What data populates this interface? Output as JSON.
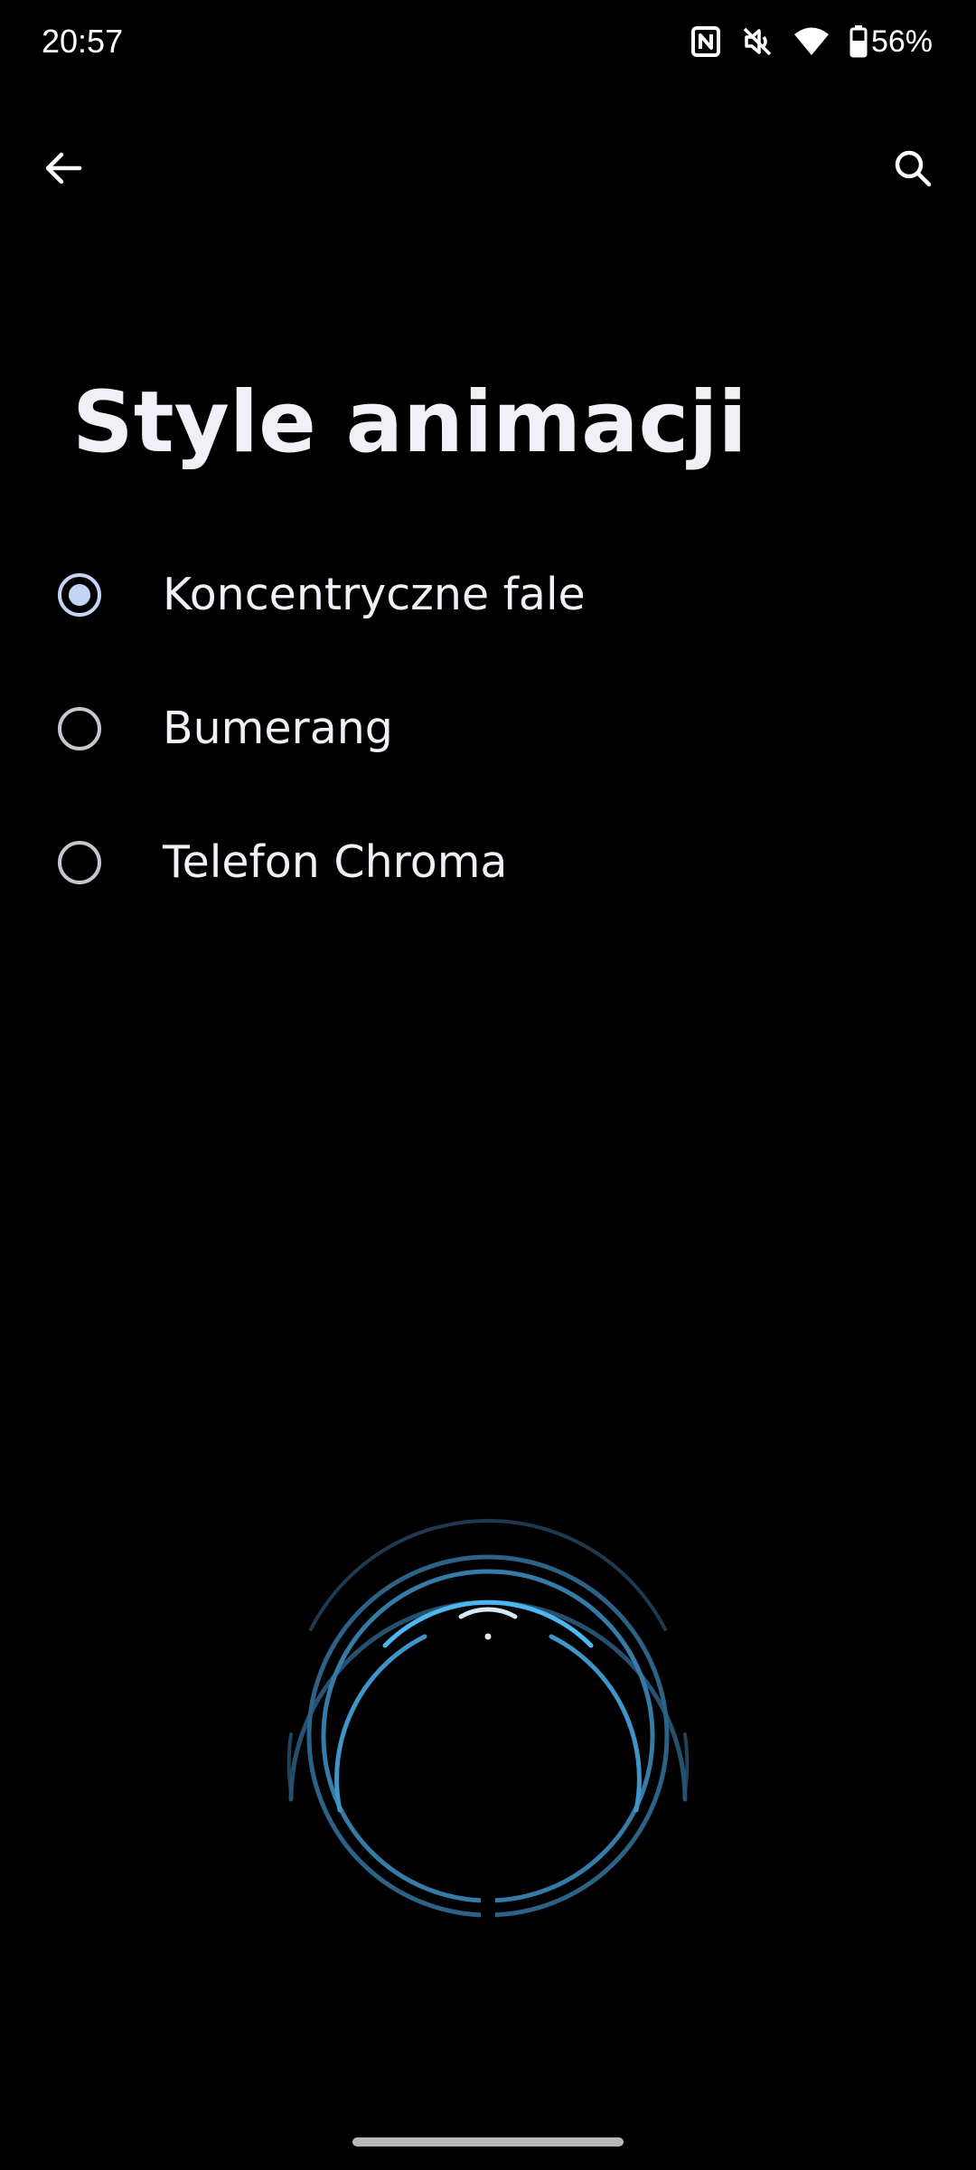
{
  "status_bar": {
    "time": "20:57",
    "battery_percent": "56%",
    "icons": [
      "nfc-icon",
      "mute-icon",
      "wifi-icon",
      "battery-icon"
    ]
  },
  "toolbar": {
    "back_icon": "arrow-left-icon",
    "search_icon": "search-icon"
  },
  "page": {
    "title": "Style animacji"
  },
  "options": [
    {
      "label": "Koncentryczne fale",
      "selected": true
    },
    {
      "label": "Bumerang",
      "selected": false
    },
    {
      "label": "Telefon Chroma",
      "selected": false
    }
  ],
  "preview": {
    "icon": "concentric-waves-preview",
    "accent_color": "#4EB6EE"
  },
  "colors": {
    "background": "#000000",
    "text": "#F1F0F6",
    "radio_selected": "#C5D4F6",
    "radio_unselected": "#C8C6CE"
  }
}
